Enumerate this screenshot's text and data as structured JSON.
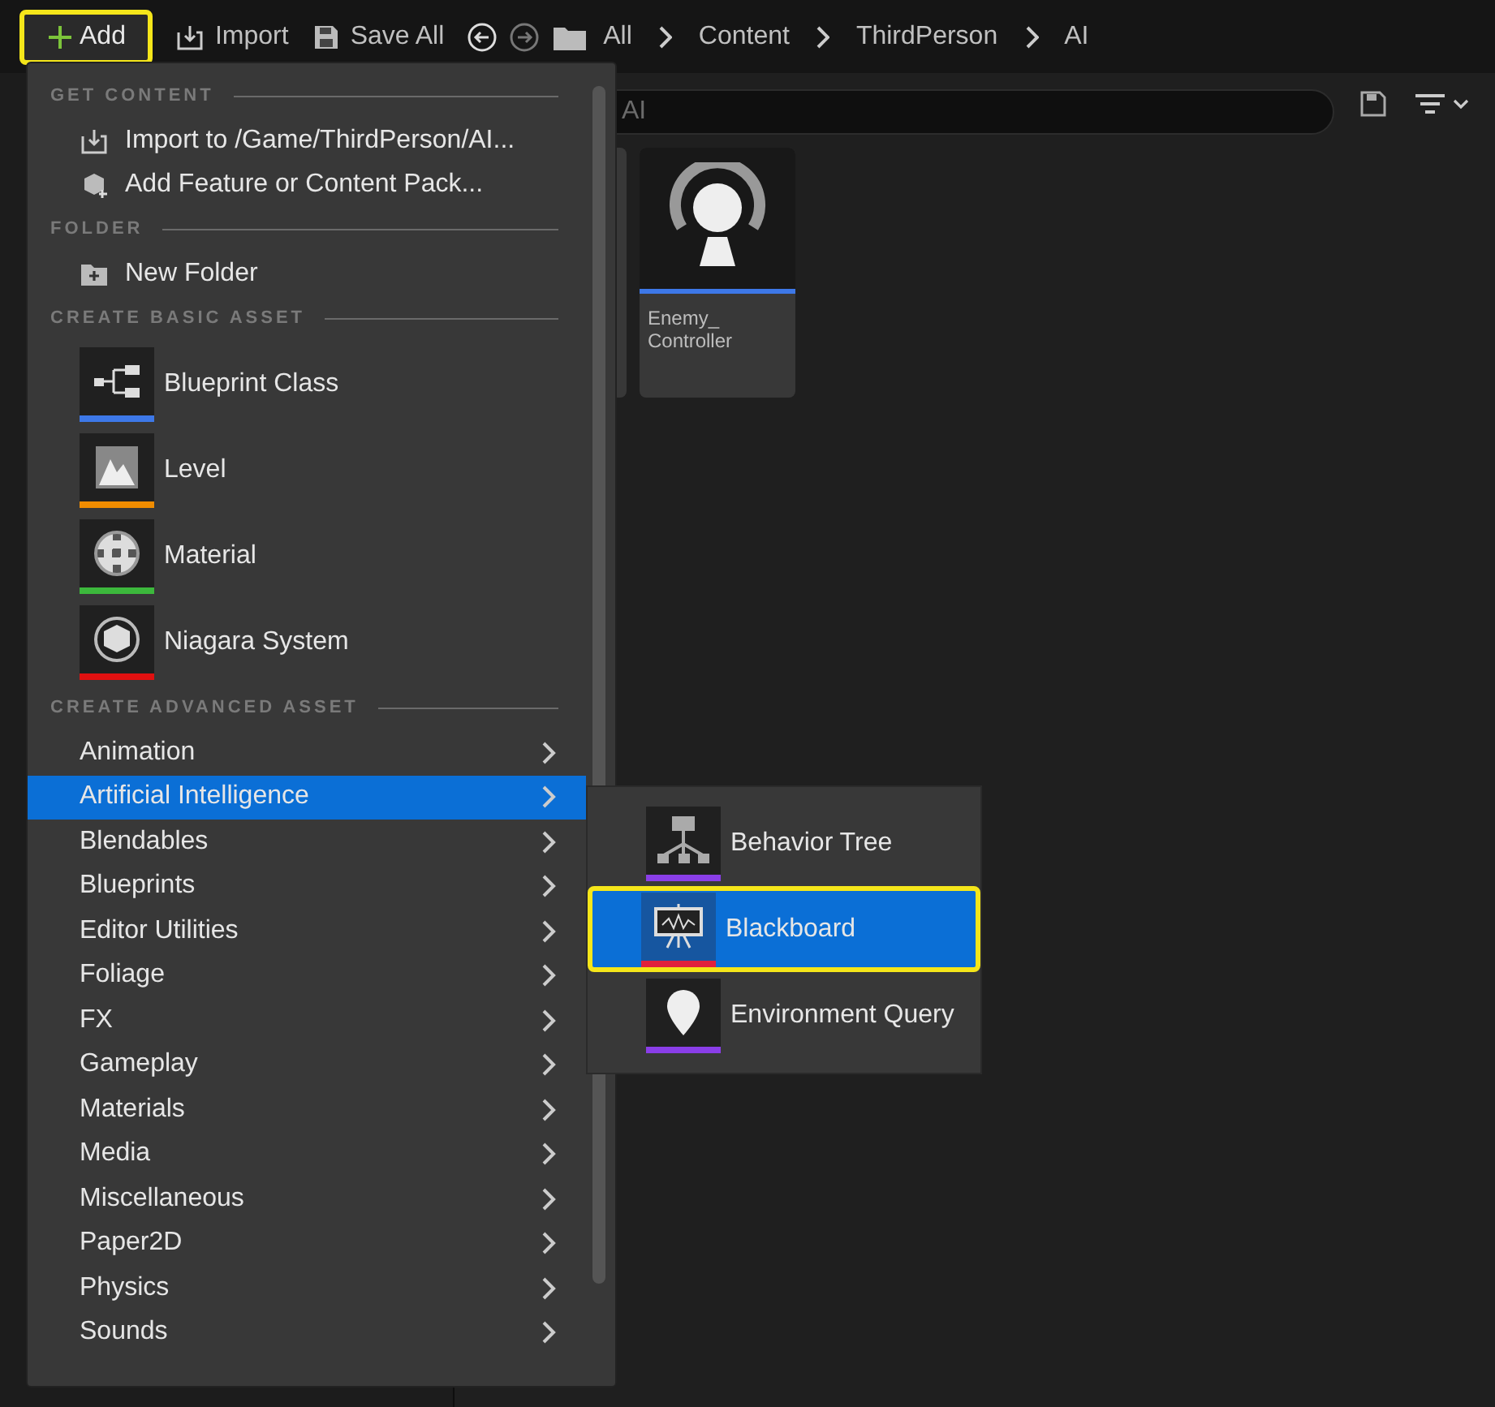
{
  "toolbar": {
    "add_button": {
      "label": "Add",
      "highlighted": true
    },
    "buttons": [
      {
        "label": "Import"
      },
      {
        "label": "Save All"
      }
    ],
    "breadcrumb": [
      "All",
      "Content",
      "ThirdPerson",
      "AI"
    ]
  },
  "search": {
    "placeholder": "AI"
  },
  "assets": [
    {
      "label": "Enemy_ Controller",
      "color": "#3d78e8"
    }
  ],
  "menu": {
    "sections": [
      {
        "title": "GET CONTENT",
        "items": [
          {
            "kind": "action",
            "label": "Import to /Game/ThirdPerson/AI..."
          },
          {
            "kind": "action",
            "label": "Add Feature or Content Pack..."
          }
        ]
      },
      {
        "title": "FOLDER",
        "items": [
          {
            "kind": "action",
            "label": "New Folder"
          }
        ]
      },
      {
        "title": "CREATE BASIC ASSET",
        "items": [
          {
            "kind": "asset",
            "label": "Blueprint Class",
            "color": "#3d78e8"
          },
          {
            "kind": "asset",
            "label": "Level",
            "color": "#f08c00"
          },
          {
            "kind": "asset",
            "label": "Material",
            "color": "#3cb83c"
          },
          {
            "kind": "asset",
            "label": "Niagara System",
            "color": "#e01010"
          }
        ]
      },
      {
        "title": "CREATE ADVANCED ASSET",
        "items": [
          {
            "kind": "submenu",
            "label": "Animation",
            "selected": false
          },
          {
            "kind": "submenu",
            "label": "Artificial Intelligence",
            "selected": true
          },
          {
            "kind": "submenu",
            "label": "Blendables",
            "selected": false
          },
          {
            "kind": "submenu",
            "label": "Blueprints",
            "selected": false
          },
          {
            "kind": "submenu",
            "label": "Editor Utilities",
            "selected": false
          },
          {
            "kind": "submenu",
            "label": "Foliage",
            "selected": false
          },
          {
            "kind": "submenu",
            "label": "FX",
            "selected": false
          },
          {
            "kind": "submenu",
            "label": "Gameplay",
            "selected": false
          },
          {
            "kind": "submenu",
            "label": "Materials",
            "selected": false
          },
          {
            "kind": "submenu",
            "label": "Media",
            "selected": false
          },
          {
            "kind": "submenu",
            "label": "Miscellaneous",
            "selected": false
          },
          {
            "kind": "submenu",
            "label": "Paper2D",
            "selected": false
          },
          {
            "kind": "submenu",
            "label": "Physics",
            "selected": false
          },
          {
            "kind": "submenu",
            "label": "Sounds",
            "selected": false
          }
        ]
      }
    ]
  },
  "submenu": {
    "items": [
      {
        "label": "Behavior Tree",
        "color": "#8a3ee8",
        "selected": false,
        "highlighted": false
      },
      {
        "label": "Blackboard",
        "color": "#e0203c",
        "selected": true,
        "highlighted": true
      },
      {
        "label": "Environment Query",
        "color": "#8a3ee8",
        "selected": false,
        "highlighted": false
      }
    ]
  }
}
